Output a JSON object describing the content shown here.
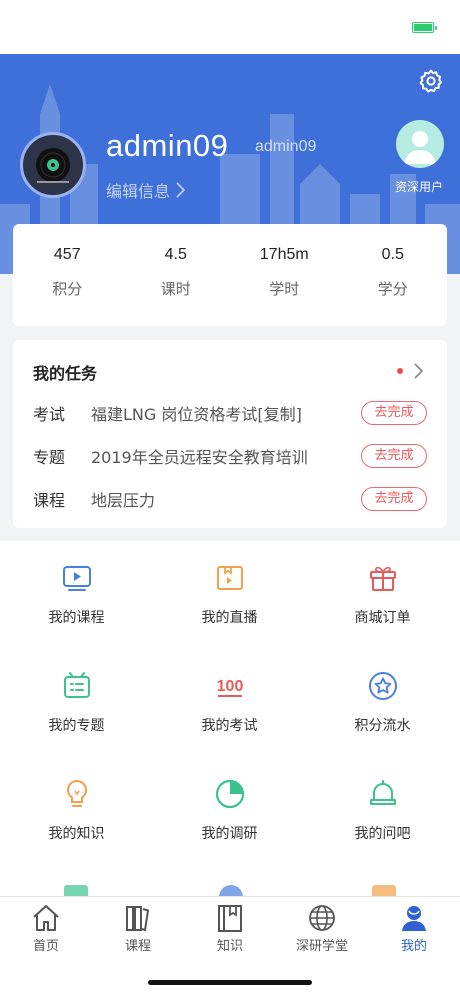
{
  "profile": {
    "username": "admin09",
    "login_id": "admin09",
    "edit_label": "编辑信息",
    "level_label": "资深用户"
  },
  "stats": [
    {
      "value": "457",
      "label": "积分"
    },
    {
      "value": "4.5",
      "label": "课时"
    },
    {
      "value": "17h5m",
      "label": "学时"
    },
    {
      "value": "0.5",
      "label": "学分"
    }
  ],
  "tasks": {
    "title": "我的任务",
    "items": [
      {
        "type": "考试",
        "name": "福建LNG 岗位资格考试[复制]",
        "action": "去完成"
      },
      {
        "type": "专题",
        "name": "2019年全员远程安全教育培训",
        "action": "去完成"
      },
      {
        "type": "课程",
        "name": "地层压力",
        "action": "去完成"
      }
    ]
  },
  "menu": [
    {
      "label": "我的课程",
      "icon": "video-play-icon",
      "color": "#4a7fe0"
    },
    {
      "label": "我的直播",
      "icon": "live-bookmark-icon",
      "color": "#f0a24a"
    },
    {
      "label": "商城订单",
      "icon": "gift-box-icon",
      "color": "#ea5a5a"
    },
    {
      "label": "我的专题",
      "icon": "topic-board-icon",
      "color": "#3cc28e"
    },
    {
      "label": "我的考试",
      "icon": "score-100-icon",
      "color": "#ea5a5a"
    },
    {
      "label": "积分流水",
      "icon": "star-badge-icon",
      "color": "#4a7fe0"
    },
    {
      "label": "我的知识",
      "icon": "lightbulb-icon",
      "color": "#f0a24a"
    },
    {
      "label": "我的调研",
      "icon": "pie-chart-icon",
      "color": "#3cc28e"
    },
    {
      "label": "我的问吧",
      "icon": "bell-icon",
      "color": "#3cc28e"
    }
  ],
  "tabs": [
    {
      "label": "首页",
      "icon": "home-icon"
    },
    {
      "label": "课程",
      "icon": "books-icon"
    },
    {
      "label": "知识",
      "icon": "book-icon"
    },
    {
      "label": "深研学堂",
      "icon": "globe-icon"
    },
    {
      "label": "我的",
      "icon": "user-icon",
      "active": true
    }
  ],
  "colors": {
    "header_blue": "#3f6fd8",
    "accent_red": "#ea5a5a",
    "tab_active": "#2e62d4"
  }
}
